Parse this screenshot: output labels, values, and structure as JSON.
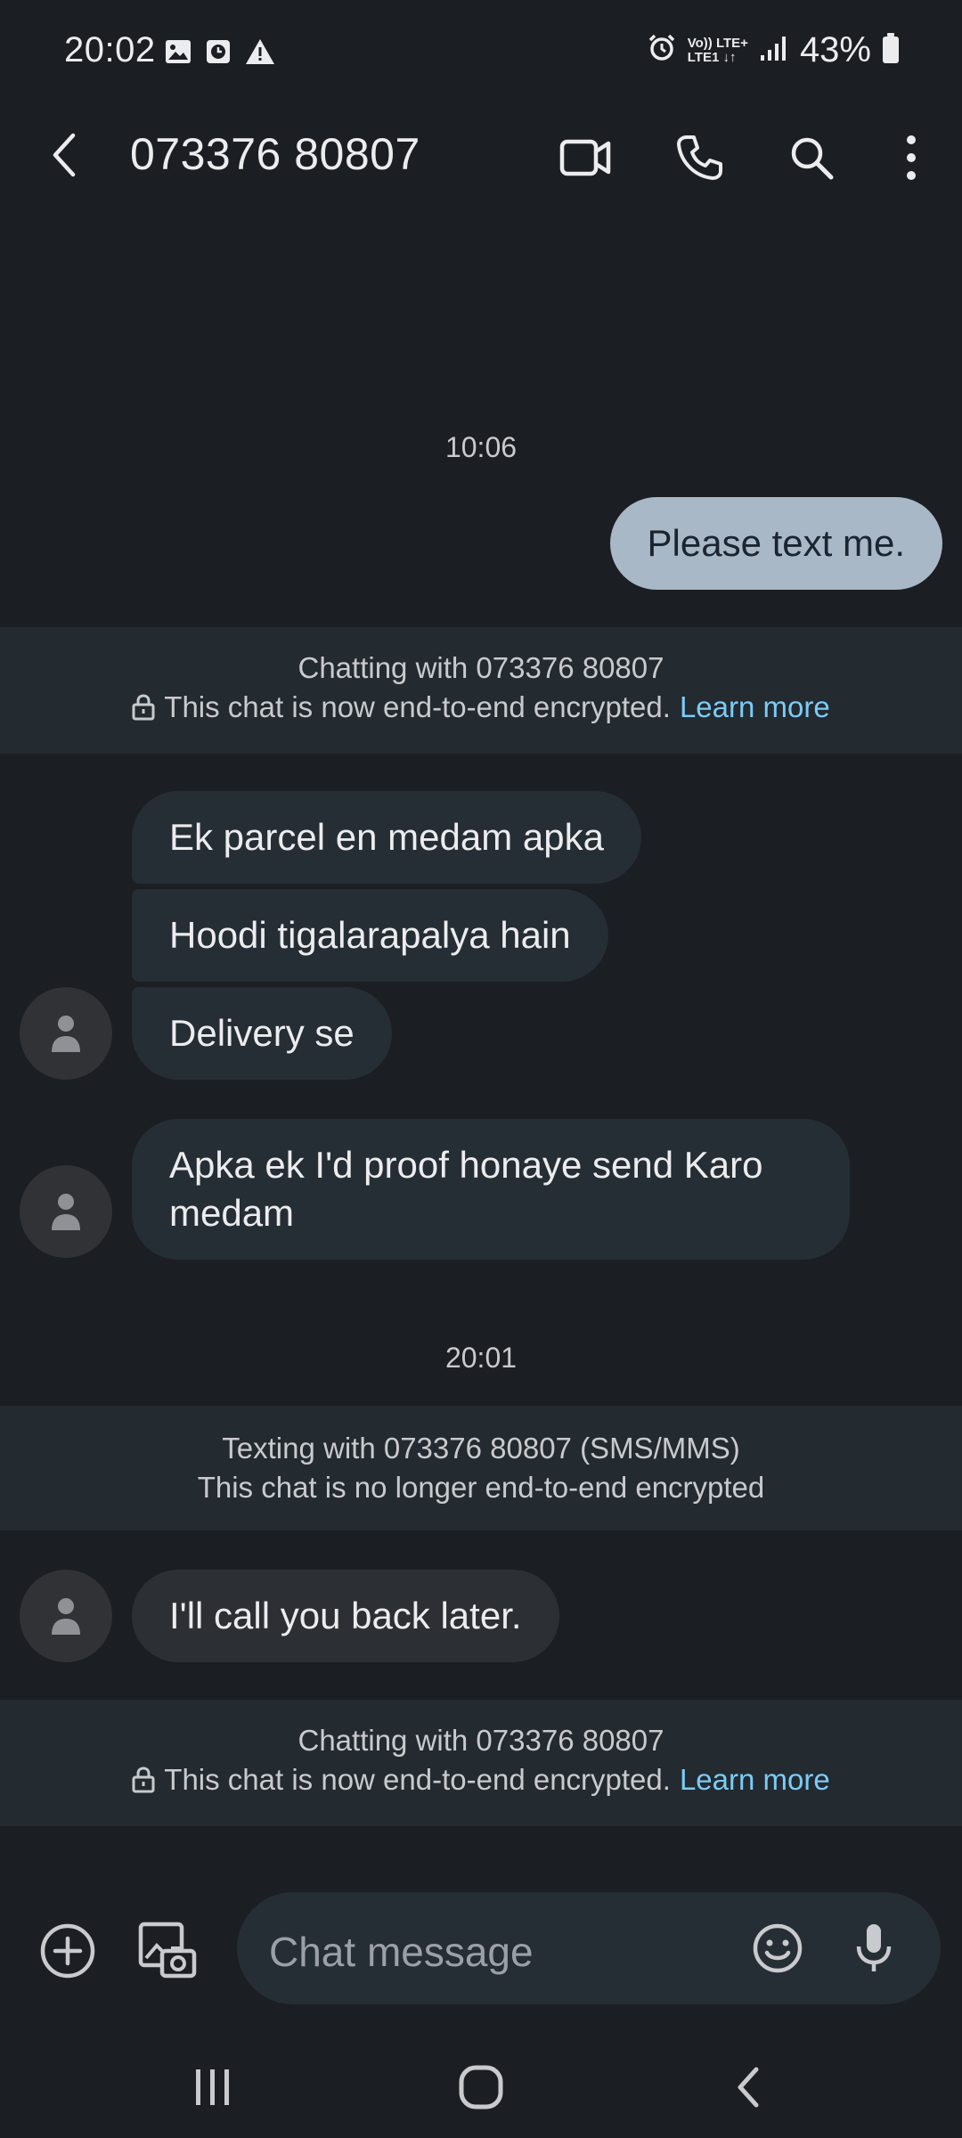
{
  "status_bar": {
    "time": "20:02",
    "network_top": "Vo)) LTE+",
    "network_bottom": "LTE1 ↓↑",
    "battery": "43%"
  },
  "app_bar": {
    "title": "073376 80807",
    "icons": [
      "back-arrow-icon",
      "video-call-icon",
      "phone-icon",
      "search-icon",
      "more-vert-icon"
    ]
  },
  "conversation": {
    "timestamp_1": "10:06",
    "outgoing_1": "Please text me.",
    "banner_1": {
      "line1": "Chatting with 073376 80807",
      "line2": "This chat is now end-to-end encrypted.",
      "link": "Learn more"
    },
    "incoming_1": "Ek parcel en medam apka",
    "incoming_2": "Hoodi tigalarapalya hain",
    "incoming_3": "Delivery se",
    "incoming_4": "Apka ek I'd proof honaye send Karo medam",
    "timestamp_2": "20:01",
    "banner_2": {
      "line1": "Texting with 073376 80807 (SMS/MMS)",
      "line2": "This chat is no longer end-to-end encrypted"
    },
    "incoming_5": "I'll call you back later.",
    "banner_3": {
      "line1": "Chatting with 073376 80807",
      "line2": "This chat is now end-to-end encrypted.",
      "link": "Learn more"
    }
  },
  "compose": {
    "placeholder": "Chat message"
  },
  "colors": {
    "background": "#1b1e22",
    "outgoing_bubble": "#a8b8c7",
    "incoming_bubble": "#252e35",
    "banner": "#232a30",
    "link": "#7ccbf5"
  }
}
